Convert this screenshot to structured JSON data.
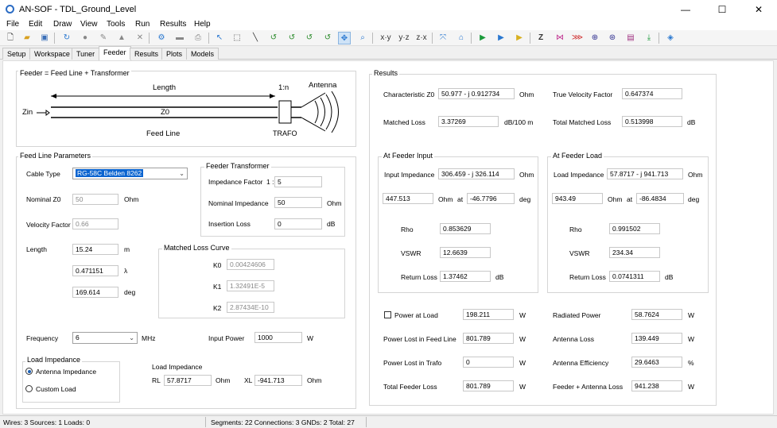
{
  "window": {
    "title": "AN-SOF - TDL_Ground_Level",
    "controls": {
      "minimize": "—",
      "maximize": "☐",
      "close": "✕"
    }
  },
  "menu": [
    "File",
    "Edit",
    "Draw",
    "View",
    "Tools",
    "Run",
    "Results",
    "Help"
  ],
  "toolbar": {
    "icons": [
      "new-icon",
      "open-icon",
      "save-icon",
      "refresh-icon",
      "stop-icon",
      "pencil-icon",
      "eraser-icon",
      "delete-icon",
      "gear-icon",
      "comment-icon",
      "print-icon",
      "pointer-icon",
      "select-rect-icon",
      "line-icon",
      "rotate-x-icon",
      "rotate-y-icon",
      "rotate-z-icon",
      "rotate-xyz-icon",
      "pan-icon",
      "zoom-icon",
      "xy-view-icon",
      "yz-view-icon",
      "zx-view-icon",
      "fit-icon",
      "home-icon",
      "run-icon",
      "run-next-icon",
      "run-all-icon",
      "impedance-icon",
      "current-icon",
      "swr-icon",
      "pattern-icon",
      "pattern-3d-icon",
      "plot-icon",
      "export-icon",
      "layers-icon"
    ],
    "text": {
      "xy": "x·y",
      "yz": "y·z",
      "zx": "z·x"
    }
  },
  "tabs": [
    "Setup",
    "Workspace",
    "Tuner",
    "Feeder",
    "Results",
    "Plots",
    "Models"
  ],
  "active_tab": "Feeder",
  "feeder_diagram": {
    "title": "Feeder = Feed Line + Transformer",
    "length_label": "Length",
    "ratio_label": "1:n",
    "antenna_label": "Antenna",
    "zin_label": "Zin",
    "z0_label": "Z0",
    "feed_line_label": "Feed Line",
    "trafo_label": "TRAFO"
  },
  "feed_line": {
    "title": "Feed Line Parameters",
    "cable_type_label": "Cable Type",
    "cable_type_value": "RG-58C Belden 8262",
    "nominal_z0_label": "Nominal Z0",
    "nominal_z0_value": "50",
    "nominal_z0_unit": "Ohm",
    "velocity_factor_label": "Velocity Factor",
    "velocity_factor_value": "0.66",
    "length_label": "Length",
    "length_m": "15.24",
    "length_m_unit": "m",
    "length_lambda": "0.471151",
    "length_lambda_unit": "λ",
    "length_deg": "169.614",
    "length_deg_unit": "deg",
    "frequency_label": "Frequency",
    "frequency_value": "6",
    "frequency_unit": "MHz",
    "input_power_label": "Input Power",
    "input_power_value": "1000",
    "input_power_unit": "W"
  },
  "transformer": {
    "title": "Feeder Transformer",
    "impedance_factor_label": "Impedance Factor",
    "impedance_factor_prefix": "1 :",
    "impedance_factor_value": "5",
    "nominal_impedance_label": "Nominal Impedance",
    "nominal_impedance_value": "50",
    "nominal_impedance_unit": "Ohm",
    "insertion_loss_label": "Insertion Loss",
    "insertion_loss_value": "0",
    "insertion_loss_unit": "dB"
  },
  "loss_curve": {
    "title": "Matched Loss Curve",
    "k0_label": "K0",
    "k0_value": "0.00424606",
    "k1_label": "K1",
    "k1_value": "1.32491E-5",
    "k2_label": "K2",
    "k2_value": "2.87434E-10"
  },
  "load": {
    "title": "Load Impedance",
    "option_antenna": "Antenna Impedance",
    "option_custom": "Custom Load",
    "selected": "Antenna Impedance",
    "imp_title": "Load Impedance",
    "rl_label": "RL",
    "rl_value": "57.8717",
    "rl_unit": "Ohm",
    "xl_label": "XL",
    "xl_value": "-941.713",
    "xl_unit": "Ohm"
  },
  "results": {
    "title": "Results",
    "char_z0_label": "Characteristic Z0",
    "char_z0_value": "50.977 - j 0.912734",
    "char_z0_unit": "Ohm",
    "true_vf_label": "True Velocity Factor",
    "true_vf_value": "0.647374",
    "matched_loss_label": "Matched Loss",
    "matched_loss_value": "3.37269",
    "matched_loss_unit": "dB/100 m",
    "total_matched_loss_label": "Total Matched Loss",
    "total_matched_loss_value": "0.513998",
    "total_matched_loss_unit": "dB",
    "input": {
      "title": "At Feeder Input",
      "imp_label": "Input Impedance",
      "imp_value": "306.459 - j 326.114",
      "imp_unit": "Ohm",
      "mag_value": "447.513",
      "mag_unit": "Ohm",
      "at_label": "at",
      "phase_value": "-46.7796",
      "phase_unit": "deg",
      "rho_label": "Rho",
      "rho_value": "0.853629",
      "vswr_label": "VSWR",
      "vswr_value": "12.6639",
      "rl_label": "Return Loss",
      "rl_value": "1.37462",
      "rl_unit": "dB"
    },
    "load": {
      "title": "At Feeder Load",
      "imp_label": "Load Impedance",
      "imp_value": "57.8717 - j 941.713",
      "imp_unit": "Ohm",
      "mag_value": "943.49",
      "mag_unit": "Ohm",
      "at_label": "at",
      "phase_value": "-86.4834",
      "phase_unit": "deg",
      "rho_label": "Rho",
      "rho_value": "0.991502",
      "vswr_label": "VSWR",
      "vswr_value": "234.34",
      "rl_label": "Return Loss",
      "rl_value": "0.0741311",
      "rl_unit": "dB"
    },
    "power": {
      "power_at_load_label": "Power at Load",
      "power_at_load_value": "198.211",
      "power_at_load_unit": "W",
      "radiated_label": "Radiated Power",
      "radiated_value": "58.7624",
      "radiated_unit": "W",
      "lost_feed_label": "Power Lost in Feed Line",
      "lost_feed_value": "801.789",
      "lost_feed_unit": "W",
      "antenna_loss_label": "Antenna Loss",
      "antenna_loss_value": "139.449",
      "antenna_loss_unit": "W",
      "lost_trafo_label": "Power Lost in Trafo",
      "lost_trafo_value": "0",
      "lost_trafo_unit": "W",
      "efficiency_label": "Antenna Efficiency",
      "efficiency_value": "29.6463",
      "efficiency_unit": "%",
      "total_feeder_label": "Total Feeder Loss",
      "total_feeder_value": "801.789",
      "total_feeder_unit": "W",
      "feeder_antenna_label": "Feeder + Antenna Loss",
      "feeder_antenna_value": "941.238",
      "feeder_antenna_unit": "W"
    }
  },
  "status": {
    "left": "Wires: 3  Sources: 1  Loads: 0",
    "right": "Segments: 22  Connections: 3  GNDs: 2  Total: 27"
  }
}
